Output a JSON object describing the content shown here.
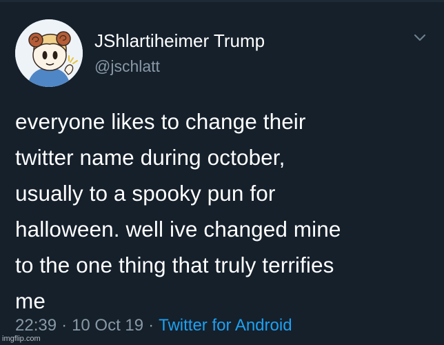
{
  "user": {
    "display_name": "JShlartiheimer Trump",
    "handle": "@jschlatt"
  },
  "tweet": {
    "text": "everyone likes to change their\ntwitter name during october,\nusually to a spooky pun for\nhalloween. well ive changed mine\nto the one thing that truly terrifies\nme",
    "time": "22:39",
    "separator": "·",
    "date": "10 Oct 19",
    "source": "Twitter for Android"
  },
  "watermark": "imgflip.com",
  "icons": {
    "menu": "chevron-down-icon"
  },
  "colors": {
    "background": "#15202b",
    "text": "#ffffff",
    "secondary_text": "#8899a6",
    "link": "#1da1f2"
  }
}
